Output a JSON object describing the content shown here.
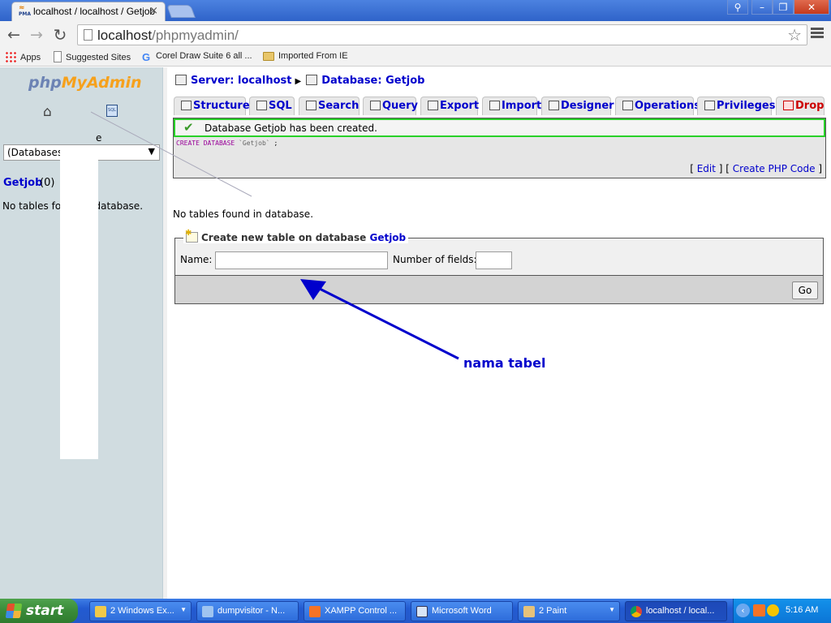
{
  "browser": {
    "tab_title": "localhost / localhost / Getjob",
    "tab_close": "×",
    "favicon_text": "PMA",
    "url_host": "localhost",
    "url_path": "/phpmyadmin/",
    "bookmarks": [
      {
        "label": "Apps"
      },
      {
        "label": "Suggested Sites"
      },
      {
        "label": "Corel Draw Suite 6 all ..."
      },
      {
        "label": "Imported From IE"
      }
    ]
  },
  "left": {
    "logo_a": "php",
    "logo_b": "MyAdmin",
    "db_label_fragment": "e",
    "db_select_value": "(Databases",
    "db_link": "Getjob",
    "db_count": "(0)",
    "no_tables": "No tables found in database."
  },
  "main": {
    "server_label": "Server: localhost",
    "database_label": "Database: Getjob",
    "tabs": [
      {
        "label": "Structure"
      },
      {
        "label": "SQL"
      },
      {
        "label": "Search"
      },
      {
        "label": "Query"
      },
      {
        "label": "Export"
      },
      {
        "label": "Import"
      },
      {
        "label": "Designer"
      },
      {
        "label": "Operations"
      },
      {
        "label": "Privileges"
      },
      {
        "label": "Drop"
      }
    ],
    "success_message": "Database Getjob has been created.",
    "sql_keyword": "CREATE DATABASE",
    "sql_identifier": "`Getjob`",
    "sql_end": ";",
    "edit_link": "Edit",
    "create_php_link": "Create PHP Code",
    "no_tables": "No tables found in database.",
    "create_legend": "Create new table on database",
    "create_db": "Getjob",
    "name_label": "Name:",
    "name_value": "",
    "fields_label": "Number of fields:",
    "fields_value": "",
    "go_label": "Go"
  },
  "annotation": {
    "text": "nama tabel",
    "color": "#0000cc"
  },
  "taskbar": {
    "start_label": "start",
    "tasks": [
      {
        "label": "2 Windows Ex..."
      },
      {
        "label": "dumpvisitor - N..."
      },
      {
        "label": "XAMPP Control ..."
      },
      {
        "label": "Microsoft Word"
      },
      {
        "label": "2 Paint"
      },
      {
        "label": "localhost / local..."
      }
    ],
    "clock": "5:16 AM"
  }
}
